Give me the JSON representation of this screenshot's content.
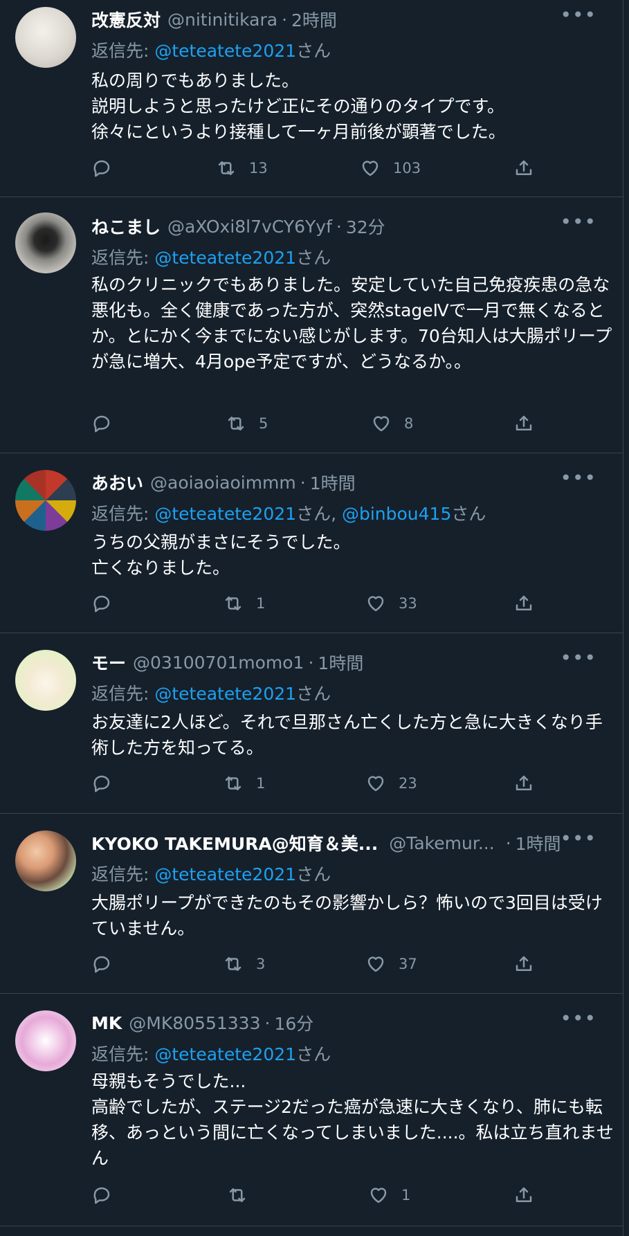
{
  "tweets": [
    {
      "name": "改憲反対",
      "handle": "@nitinitikara",
      "dot": "·",
      "time": "2時間",
      "reply_prefix": "返信先: ",
      "mentions": [
        {
          "handle": "@teteatete2021",
          "suffix": "さん"
        }
      ],
      "body": "私の周りでもありました。\n説明しようと思ったけど正にその通りのタイプです。\n徐々にというより接種して一ヶ月前後が顕著でした。",
      "retweets": "13",
      "likes": "103"
    },
    {
      "name": "ねこまし",
      "handle": "@aXOxi8l7vCY6Yyf",
      "dot": "·",
      "time": "32分",
      "reply_prefix": "返信先: ",
      "mentions": [
        {
          "handle": "@teteatete2021",
          "suffix": "さん"
        }
      ],
      "body": "私のクリニックでもありました。安定していた自己免疫疾患の急な悪化も。全く健康であった方が、突然stageⅣで一月で無くなるとか。とにかく今までにない感じがします。70台知人は大腸ポリープが急に増大、4月ope予定ですが、どうなるか。。",
      "retweets": "5",
      "likes": "8"
    },
    {
      "name": "あおい",
      "handle": "@aoiaoiaoimmm",
      "dot": "·",
      "time": "1時間",
      "reply_prefix": "返信先: ",
      "mentions": [
        {
          "handle": "@teteatete2021",
          "suffix": "さん, "
        },
        {
          "handle": "@binbou415",
          "suffix": "さん"
        }
      ],
      "body": "うちの父親がまさにそうでした。\n亡くなりました。",
      "retweets": "1",
      "likes": "33"
    },
    {
      "name": "モー",
      "handle": "@03100701momo1",
      "dot": "·",
      "time": "1時間",
      "reply_prefix": "返信先: ",
      "mentions": [
        {
          "handle": "@teteatete2021",
          "suffix": "さん"
        }
      ],
      "body": "お友達に2人ほど。それで旦那さん亡くした方と急に大きくなり手術した方を知ってる。",
      "retweets": "1",
      "likes": "23"
    },
    {
      "name": "KYOKO TAKEMURA@知育＆美...",
      "handle": "@Takemur...",
      "dot": "·",
      "time": "1時間",
      "reply_prefix": "返信先: ",
      "mentions": [
        {
          "handle": "@teteatete2021",
          "suffix": "さん"
        }
      ],
      "body": "大腸ポリープができたのもその影響かしら？怖いので3回目は受けていません。",
      "retweets": "3",
      "likes": "37"
    },
    {
      "name": "MK",
      "handle": "@MK80551333",
      "dot": "·",
      "time": "16分",
      "reply_prefix": "返信先: ",
      "mentions": [
        {
          "handle": "@teteatete2021",
          "suffix": "さん"
        }
      ],
      "body": "母親もそうでした...\n高齢でしたが、ステージ2だった癌が急速に大きくなり、肺にも転移、あっという間に亡くなってしまいました....。私は立ち直れません",
      "retweets": "",
      "likes": "1"
    }
  ],
  "icons": {
    "more": "more-horizontal-icon",
    "reply": "reply-bubble-icon",
    "retweet": "retweet-arrows-icon",
    "like": "heart-icon",
    "share": "share-upload-icon"
  },
  "colors": {
    "background": "#15202b",
    "divider": "#38444d",
    "text": "#ffffff",
    "muted": "#8899a6",
    "link": "#1da1f2"
  }
}
